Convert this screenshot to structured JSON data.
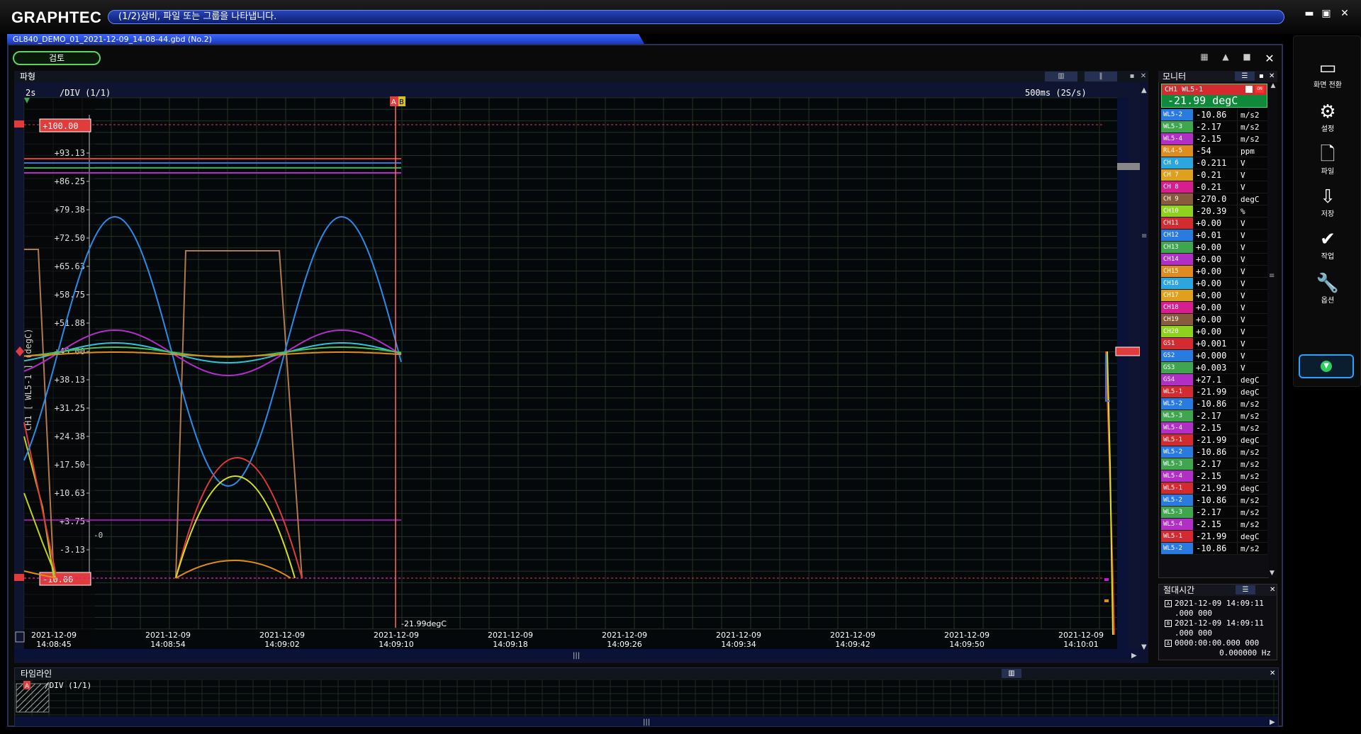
{
  "app": {
    "logo": "GRAPHTEC",
    "message": "(1/2)상비, 파일 또는 그룹을 나타냅니다.",
    "file_tab": "GL840_DEMO_01_2021-12-09_14-08-44.gbd (No.2)",
    "review_button": "검토"
  },
  "wave": {
    "title": "파형",
    "div_left": "2s",
    "div_center": "/DIV (1/1)",
    "sample_rate": "500ms (2S/s)",
    "y_axis_label": "CH1 [ WL5-1 ] (degC)",
    "y_max_badge": "+100.00",
    "y_min_badge": "-10.00",
    "cursor_a": "A",
    "cursor_b": "B",
    "cursor_readout": "-21.99degC",
    "zero_label": "-0",
    "y_ticks": [
      "+100.00",
      "+93.13",
      "+86.25",
      "+79.38",
      "+72.50",
      "+65.63",
      "+58.75",
      "+51.88",
      "+45.00",
      "+38.13",
      "+31.25",
      "+24.38",
      "+17.50",
      "+10.63",
      "+3.75",
      "-3.13",
      "-10.00"
    ],
    "x_ticks": [
      {
        "date": "2021-12-09",
        "time": "14:08:45"
      },
      {
        "date": "2021-12-09",
        "time": "14:08:54"
      },
      {
        "date": "2021-12-09",
        "time": "14:09:02"
      },
      {
        "date": "2021-12-09",
        "time": "14:09:10"
      },
      {
        "date": "2021-12-09",
        "time": "14:09:18"
      },
      {
        "date": "2021-12-09",
        "time": "14:09:26"
      },
      {
        "date": "2021-12-09",
        "time": "14:09:34"
      },
      {
        "date": "2021-12-09",
        "time": "14:09:42"
      },
      {
        "date": "2021-12-09",
        "time": "14:09:50"
      },
      {
        "date": "2021-12-09",
        "time": "14:10:01"
      }
    ]
  },
  "monitor": {
    "title": "모니터",
    "selected": {
      "label": "CH1 WL5-1",
      "value": "-21.99 degC"
    },
    "rows": [
      {
        "label": "WL5-2",
        "value": "-10.86",
        "unit": "m/s2",
        "color": "#2a7be0"
      },
      {
        "label": "WL5-3",
        "value": "-2.17",
        "unit": "m/s2",
        "color": "#3fa64f"
      },
      {
        "label": "WL5-4",
        "value": "-2.15",
        "unit": "m/s2",
        "color": "#b12fc4"
      },
      {
        "label": "RL4-5",
        "value": "-54",
        "unit": "ppm",
        "color": "#e08b1e"
      },
      {
        "label": "CH 6",
        "value": "-0.211",
        "unit": "V",
        "color": "#2da6e0"
      },
      {
        "label": "CH 7",
        "value": "-0.21",
        "unit": "V",
        "color": "#e0a01e"
      },
      {
        "label": "CH 8",
        "value": "-0.21",
        "unit": "V",
        "color": "#d61e8e"
      },
      {
        "label": "CH 9",
        "value": "-270.0",
        "unit": "degC",
        "color": "#8a5a3c"
      },
      {
        "label": "CH10",
        "value": "-20.39",
        "unit": "%",
        "color": "#8ed11e"
      },
      {
        "label": "CH11",
        "value": "+0.00",
        "unit": "V",
        "color": "#d32b30"
      },
      {
        "label": "CH12",
        "value": "+0.01",
        "unit": "V",
        "color": "#2a7be0"
      },
      {
        "label": "CH13",
        "value": "+0.00",
        "unit": "V",
        "color": "#3fa64f"
      },
      {
        "label": "CH14",
        "value": "+0.00",
        "unit": "V",
        "color": "#b12fc4"
      },
      {
        "label": "CH15",
        "value": "+0.00",
        "unit": "V",
        "color": "#e08b1e"
      },
      {
        "label": "CH16",
        "value": "+0.00",
        "unit": "V",
        "color": "#2da6e0"
      },
      {
        "label": "CH17",
        "value": "+0.00",
        "unit": "V",
        "color": "#e0a01e"
      },
      {
        "label": "CH18",
        "value": "+0.00",
        "unit": "V",
        "color": "#d61e8e"
      },
      {
        "label": "CH19",
        "value": "+0.00",
        "unit": "V",
        "color": "#8a5a3c"
      },
      {
        "label": "CH20",
        "value": "+0.00",
        "unit": "V",
        "color": "#8ed11e"
      },
      {
        "label": "GS1",
        "value": "+0.001",
        "unit": "V",
        "color": "#d32b30"
      },
      {
        "label": "GS2",
        "value": "+0.000",
        "unit": "V",
        "color": "#2a7be0"
      },
      {
        "label": "GS3",
        "value": "+0.003",
        "unit": "V",
        "color": "#3fa64f"
      },
      {
        "label": "GS4",
        "value": "+27.1",
        "unit": "degC",
        "color": "#b12fc4"
      },
      {
        "label": "WL5-1",
        "value": "-21.99",
        "unit": "degC",
        "color": "#d32b30"
      },
      {
        "label": "WL5-2",
        "value": "-10.86",
        "unit": "m/s2",
        "color": "#2a7be0"
      },
      {
        "label": "WL5-3",
        "value": "-2.17",
        "unit": "m/s2",
        "color": "#3fa64f"
      },
      {
        "label": "WL5-4",
        "value": "-2.15",
        "unit": "m/s2",
        "color": "#b12fc4"
      },
      {
        "label": "WL5-1",
        "value": "-21.99",
        "unit": "degC",
        "color": "#d32b30"
      },
      {
        "label": "WL5-2",
        "value": "-10.86",
        "unit": "m/s2",
        "color": "#2a7be0"
      },
      {
        "label": "WL5-3",
        "value": "-2.17",
        "unit": "m/s2",
        "color": "#3fa64f"
      },
      {
        "label": "WL5-4",
        "value": "-2.15",
        "unit": "m/s2",
        "color": "#b12fc4"
      },
      {
        "label": "WL5-1",
        "value": "-21.99",
        "unit": "degC",
        "color": "#d32b30"
      },
      {
        "label": "WL5-2",
        "value": "-10.86",
        "unit": "m/s2",
        "color": "#2a7be0"
      },
      {
        "label": "WL5-3",
        "value": "-2.17",
        "unit": "m/s2",
        "color": "#3fa64f"
      },
      {
        "label": "WL5-4",
        "value": "-2.15",
        "unit": "m/s2",
        "color": "#b12fc4"
      },
      {
        "label": "WL5-1",
        "value": "-21.99",
        "unit": "degC",
        "color": "#d32b30"
      },
      {
        "label": "WL5-2",
        "value": "-10.86",
        "unit": "m/s2",
        "color": "#2a7be0"
      }
    ]
  },
  "abs_time": {
    "title": "절대시간",
    "cursor_a_line1": "2021-12-09 14:09:11",
    "cursor_a_line2": ".000 000",
    "cursor_b_line1": "2021-12-09 14:09:11",
    "cursor_b_line2": ".000 000",
    "delta_line1": "0000:00:00.000 000",
    "delta_line2": "0.000000 Hz"
  },
  "timeline": {
    "title": "타임라인",
    "div": "/DIV (1/1)"
  },
  "sidebar": {
    "items": [
      {
        "label": "화면 전환",
        "icon": "display-switch-icon"
      },
      {
        "label": "설정",
        "icon": "gear-icon"
      },
      {
        "label": "파일",
        "icon": "file-icon"
      },
      {
        "label": "저장",
        "icon": "save-icon"
      },
      {
        "label": "작업",
        "icon": "check-icon"
      },
      {
        "label": "옵션",
        "icon": "wrench-icon"
      }
    ]
  }
}
